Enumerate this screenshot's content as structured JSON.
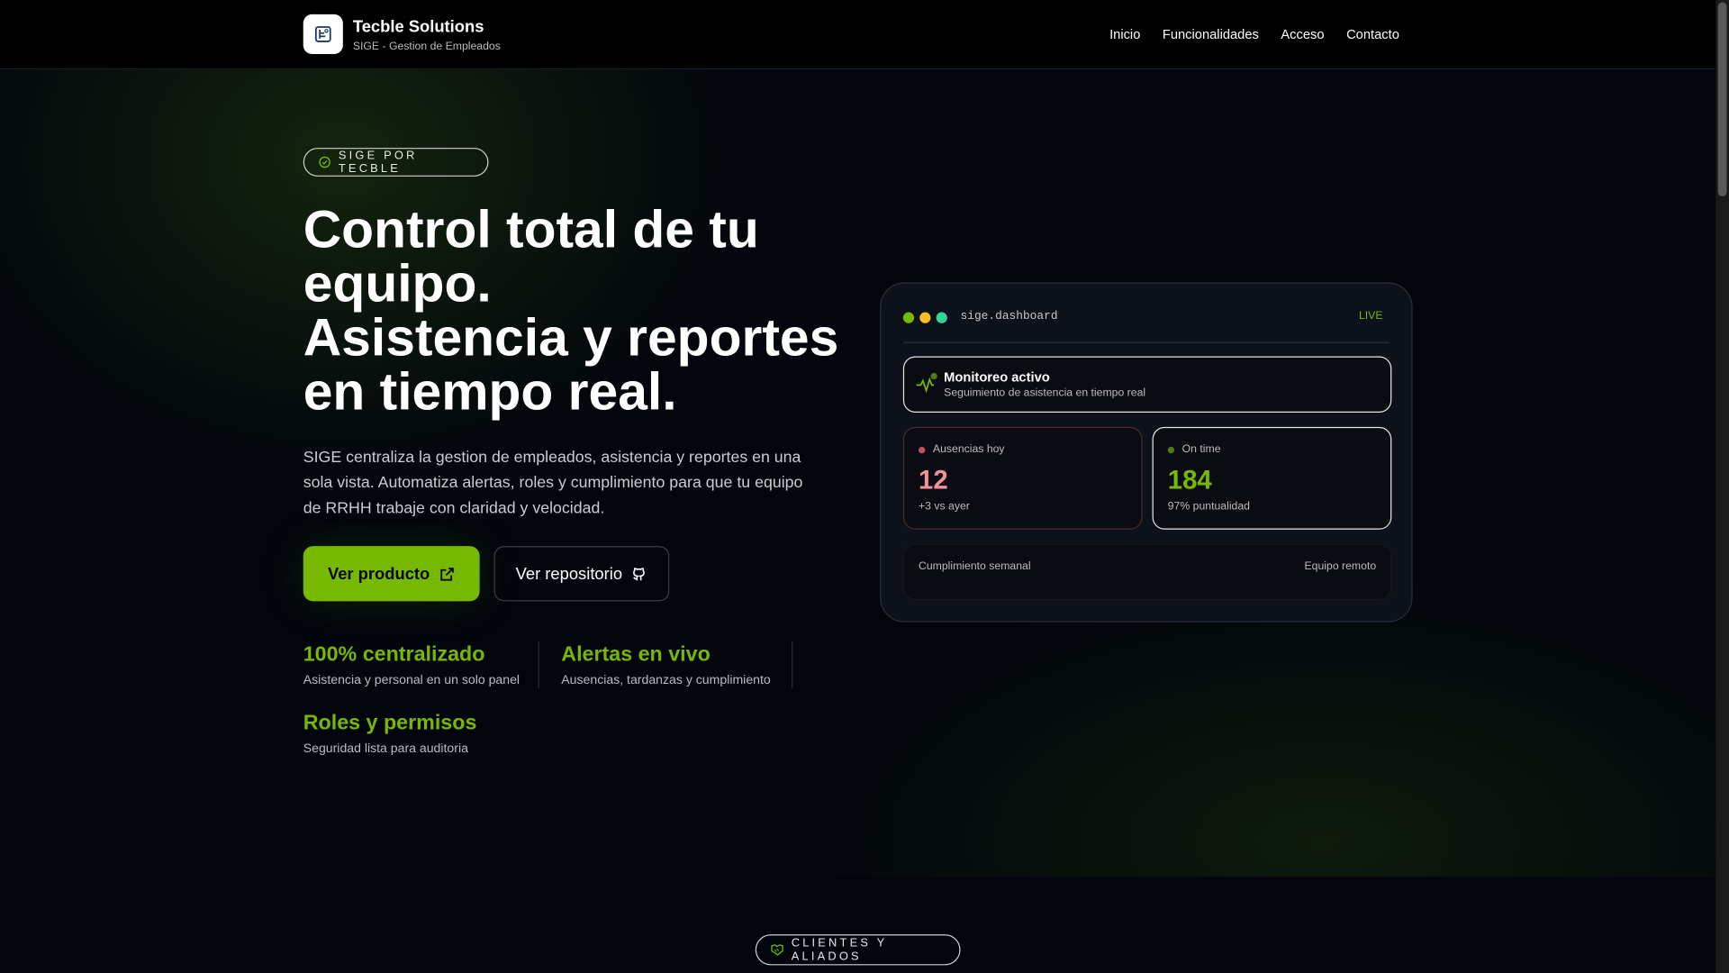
{
  "header": {
    "brand": "Tecble Solutions",
    "subtitle": "SIGE - Gestion de Empleados",
    "nav": [
      "Inicio",
      "Funcionalidades",
      "Acceso",
      "Contacto"
    ]
  },
  "hero": {
    "badge": "SIGE POR TECBLE",
    "title_lines": [
      "Control total de tu",
      "equipo.",
      "Asistencia y reportes",
      "en tiempo real."
    ],
    "description": "SIGE centraliza la gestion de empleados, asistencia y reportes en una sola vista. Automatiza alertas, roles y cumplimiento para que tu equipo de RRHH trabaje con claridad y velocidad.",
    "primary_button": "Ver producto",
    "secondary_button": "Ver repositorio",
    "stats": [
      {
        "title": "100% centralizado",
        "subtitle": "Asistencia y personal en un solo panel"
      },
      {
        "title": "Alertas en vivo",
        "subtitle": "Ausencias, tardanzas y cumplimiento"
      },
      {
        "title": "Roles y permisos",
        "subtitle": "Seguridad lista para auditoria"
      }
    ]
  },
  "dashboard": {
    "window_title": "sige.dashboard",
    "live": "LIVE",
    "monitor": {
      "title": "Monitoreo activo",
      "subtitle": "Seguimiento de asistencia en tiempo real"
    },
    "absences": {
      "label": "Ausencias hoy",
      "value": "12",
      "note": "+3 vs ayer"
    },
    "ontime": {
      "label": "On time",
      "value": "184",
      "note": "97% puntualidad"
    },
    "footer": {
      "left": "Cumplimiento semanal",
      "right": "Equipo remoto"
    }
  },
  "clients": {
    "badge": "CLIENTES Y ALIADOS"
  },
  "colors": {
    "accent": "#76b900",
    "danger": "#f0919b",
    "bg": "#02050c"
  }
}
